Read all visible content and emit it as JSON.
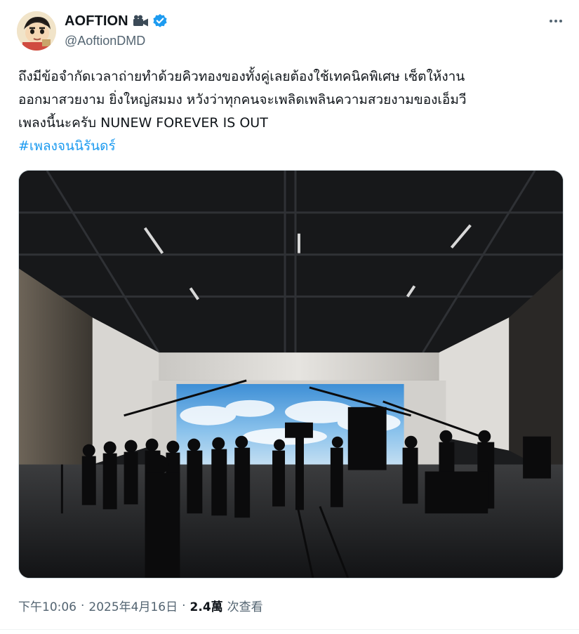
{
  "author": {
    "display_name": "AOFTION",
    "handle": "@AoftionDMD",
    "badge_icon": "camera-icon",
    "verified_icon": "verified-badge-icon",
    "verified_color": "#1d9bf0"
  },
  "more_icon": "more-options-icon",
  "tweet": {
    "lines": [
      "ถึงมีข้อจำกัดเวลาถ่ายทำด้วยคิวทองของทั้งคู่เลยต้องใช้เทคนิคพิเศษ เซ็ตให้งาน",
      "ออกมาสวยงาม ยิ่งใหญ่สมมง หวังว่าทุกคนจะเพลิดเพลินความสวยงามของเอ็มวี",
      "เพลงนี้นะครับ NUNEW FOREVER IS OUT"
    ],
    "hashtag": "#เพลงจนนิรันดร์"
  },
  "media": {
    "description_icon": "photo"
  },
  "meta": {
    "time": "下午10:06",
    "separator": "·",
    "date": "2025年4月16日",
    "views_count": "2.4萬",
    "views_label": "次查看"
  },
  "colors": {
    "text": "#0f1419",
    "secondary": "#536471",
    "link": "#1d9bf0"
  }
}
